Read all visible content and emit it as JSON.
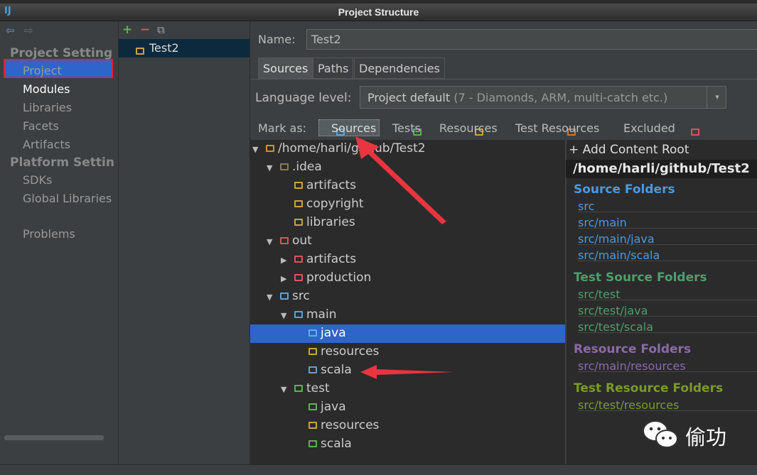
{
  "window": {
    "title": "Project Structure",
    "app_icon": "IJ"
  },
  "left": {
    "back": "⇦",
    "forward": "⇨",
    "project_settings_header": "Project Setting",
    "project_settings": [
      "Project",
      "Modules",
      "Libraries",
      "Facets",
      "Artifacts"
    ],
    "platform_settings_header": "Platform Settin",
    "platform_settings": [
      "SDKs",
      "Global Libraries"
    ],
    "problems": "Problems",
    "selected": "Modules"
  },
  "middle": {
    "add": "+",
    "remove": "−",
    "copy": "⧉",
    "module": "Test2"
  },
  "name": {
    "label": "Name:",
    "value": "Test2"
  },
  "tabs": [
    "Sources",
    "Paths",
    "Dependencies"
  ],
  "language": {
    "label": "Language level:",
    "value_main": "Project default",
    "value_detail": "(7 - Diamonds, ARM, multi-catch etc.)",
    "arrow": "▾"
  },
  "mark_as": {
    "label": "Mark as:",
    "items": [
      "Sources",
      "Tests",
      "Resources",
      "Test Resources",
      "Excluded"
    ]
  },
  "tree": [
    {
      "label": "/home/harli/github/Test2",
      "expanded": "▼",
      "color": "#c9913c"
    },
    {
      "label": ".idea",
      "expanded": "▼",
      "color": "#8a7a55"
    },
    {
      "label": "artifacts",
      "color": "#c9a444"
    },
    {
      "label": "copyright",
      "color": "#c9a444"
    },
    {
      "label": "libraries",
      "color": "#c9a444"
    },
    {
      "label": "out",
      "expanded": "▼",
      "color": "#d9555c"
    },
    {
      "label": "artifacts",
      "expanded": "▶",
      "color": "#d9555c"
    },
    {
      "label": "production",
      "expanded": "▶",
      "color": "#d9555c"
    },
    {
      "label": "src",
      "expanded": "▼",
      "color": "#5f9fd0"
    },
    {
      "label": "main",
      "expanded": "▼",
      "color": "#5f9fd0"
    },
    {
      "label": "java",
      "color": "#5fb0e8"
    },
    {
      "label": "resources",
      "color": "#c9a444"
    },
    {
      "label": "scala",
      "color": "#5f9fd0"
    },
    {
      "label": "test",
      "expanded": "▼",
      "color": "#5fb053"
    },
    {
      "label": "java",
      "color": "#5fb053"
    },
    {
      "label": "resources",
      "color": "#c9a444"
    },
    {
      "label": "scala",
      "color": "#5fb053"
    }
  ],
  "roots": {
    "add_label": "+ Add Content Root",
    "root_path": "/home/harli/github/Test2",
    "source_header": "Source Folders",
    "source_items": [
      "src",
      "src/main",
      "src/main/java",
      "src/main/scala"
    ],
    "test_header": "Test Source Folders",
    "test_items": [
      "src/test",
      "src/test/java",
      "src/test/scala"
    ],
    "resource_header": "Resource Folders",
    "resource_items": [
      "src/main/resources"
    ],
    "test_resource_header": "Test Resource Folders",
    "test_resource_items": [
      "src/test/resources"
    ]
  },
  "colors": {
    "source": "#4a9ae6",
    "test": "#4f9e6e",
    "resource": "#8a6aa8",
    "test_resource": "#7a9a2a",
    "selection": "#2f65ca",
    "annotation": "#e8353f"
  },
  "watermark": "偷功"
}
